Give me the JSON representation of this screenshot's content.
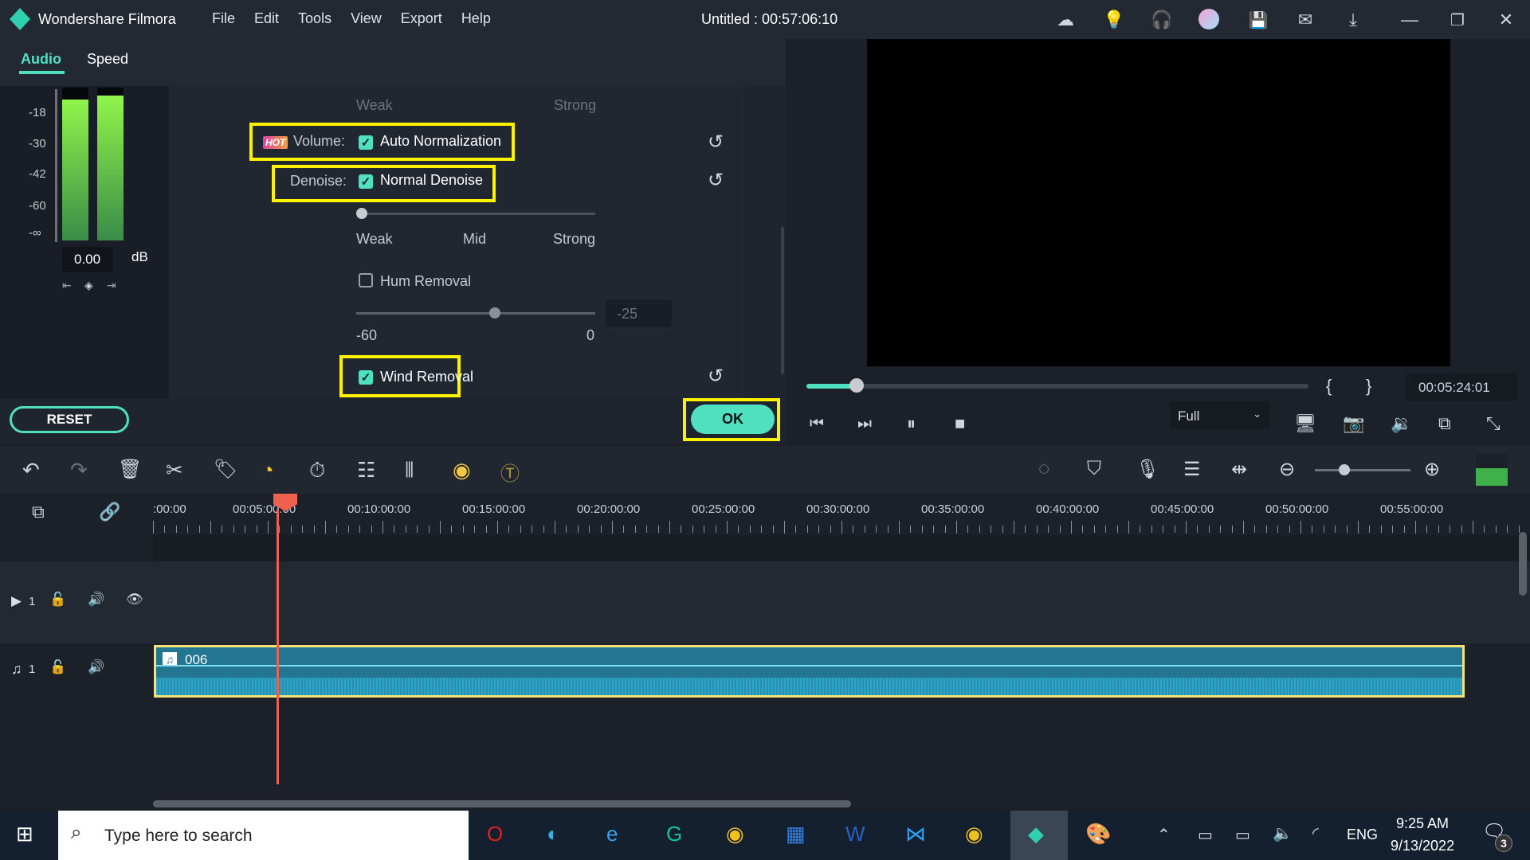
{
  "app": {
    "name": "Wondershare Filmora",
    "title": "Untitled : 00:57:06:10",
    "menu": [
      "File",
      "Edit",
      "Tools",
      "View",
      "Export",
      "Help"
    ]
  },
  "panel": {
    "tabs": [
      "Audio",
      "Speed"
    ],
    "active_tab": "Audio",
    "meter": {
      "scale": [
        "-18",
        "-30",
        "-42",
        "-60",
        "-∞"
      ],
      "value": "0.00",
      "unit": "dB",
      "levels_percent": [
        92,
        95
      ]
    },
    "top_labels": {
      "weak": "Weak",
      "strong": "Strong"
    },
    "volume": {
      "hot_badge": "HOT",
      "label": "Volume:",
      "option": "Auto Normalization",
      "checked": true
    },
    "denoise": {
      "label": "Denoise:",
      "option": "Normal Denoise",
      "checked": true,
      "levels": [
        "Weak",
        "Mid",
        "Strong"
      ],
      "level_percent": 0
    },
    "hum": {
      "label": "Hum Removal",
      "checked": false,
      "min": "-60",
      "max": "0",
      "value": "-25"
    },
    "wind": {
      "label": "Wind Removal",
      "checked": true
    },
    "reset": "RESET",
    "ok": "OK"
  },
  "preview": {
    "timecode": "00:05:24:01",
    "progress_percent": 10,
    "quality": "Full",
    "mark_in": "{",
    "mark_out": "}"
  },
  "timeline": {
    "ruler": [
      ":00:00",
      "00:05:00:00",
      "00:10:00:00",
      "00:15:00:00",
      "00:20:00:00",
      "00:25:00:00",
      "00:30:00:00",
      "00:35:00:00",
      "00:40:00:00",
      "00:45:00:00",
      "00:50:00:00",
      "00:55:00:00"
    ],
    "video_track": "1",
    "audio_track": "1",
    "clip_name": "006"
  },
  "taskbar": {
    "search_placeholder": "Type here to search",
    "time": "9:25 AM",
    "date": "9/13/2022",
    "lang": "ENG",
    "notifications": "3"
  }
}
